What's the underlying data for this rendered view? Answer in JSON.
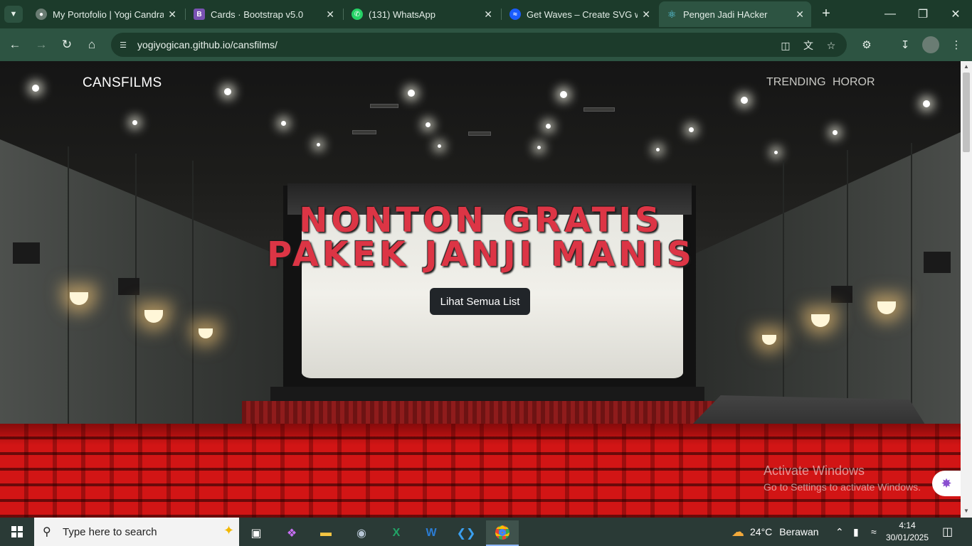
{
  "browser": {
    "tabs": [
      {
        "title": "My Portofolio | Yogi Candra",
        "favicon": "globe-icon",
        "color": "#6a7c73"
      },
      {
        "title": "Cards · Bootstrap v5.0",
        "favicon": "bootstrap-icon",
        "color": "#7952b3",
        "letter": "B"
      },
      {
        "title": "(131) WhatsApp",
        "favicon": "whatsapp-icon",
        "color": "#25d366"
      },
      {
        "title": "Get Waves – Create SVG wav",
        "favicon": "waves-icon",
        "color": "#1a5cff"
      },
      {
        "title": "Pengen Jadi HAcker",
        "favicon": "react-icon",
        "color": "#61dafb"
      }
    ],
    "active_tab": 4,
    "url": "yogiyogican.github.io/cansfilms/"
  },
  "site": {
    "brand": "CANSFILMS",
    "nav": [
      "TRENDING",
      "HOROR"
    ],
    "hero_line1": "NONTON GRATIS",
    "hero_line2": "PAKEK JANJI MANIS",
    "button": "Lihat Semua List"
  },
  "watermark": {
    "line1": "Activate Windows",
    "line2": "Go to Settings to activate Windows."
  },
  "taskbar": {
    "search_placeholder": "Type here to search",
    "weather_temp": "24°C",
    "weather_text": "Berawan",
    "time": "4:14",
    "date": "30/01/2025"
  },
  "colors": {
    "accent_red": "#dc3545",
    "browser_chrome": "#2d5442",
    "button_dark": "#212529"
  }
}
